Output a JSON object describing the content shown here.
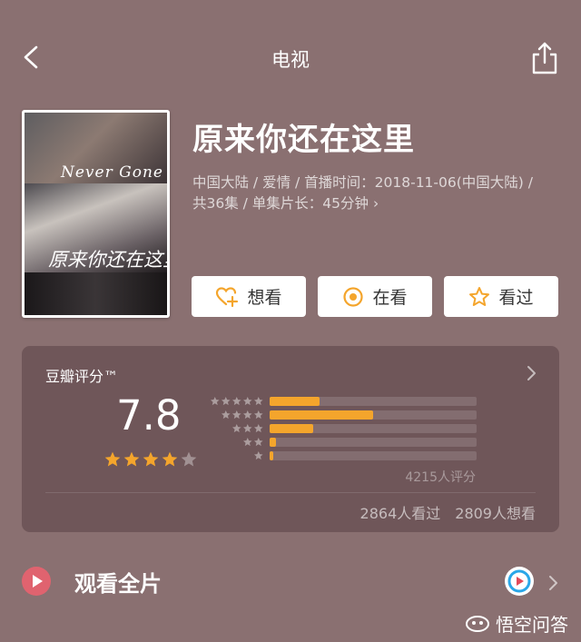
{
  "colors": {
    "background": "#8a7071",
    "star": "#f4a52c",
    "button_icon": "#f4a52c",
    "play": "#e0636f"
  },
  "nav": {
    "title": "电视"
  },
  "show": {
    "title": "原来你还在这里",
    "meta": "中国大陆 / 爱情 / 首播时间：2018-11-06(中国大陆) / 共36集 / 单集片长：45分钟 ›",
    "poster_title_en": "Never Gone",
    "poster_title_cn": "原来你还在这里"
  },
  "actions": {
    "want": "想看",
    "watching": "在看",
    "watched": "看过"
  },
  "rating": {
    "label": "豆瓣评分™",
    "score": "7.8",
    "stars": 4,
    "count": "4215人评分",
    "distribution": [
      {
        "stars": 5,
        "fraction": 0.24
      },
      {
        "stars": 4,
        "fraction": 0.5
      },
      {
        "stars": 3,
        "fraction": 0.21
      },
      {
        "stars": 2,
        "fraction": 0.03
      },
      {
        "stars": 1,
        "fraction": 0.015
      }
    ],
    "seen": "2864人看过",
    "want": "2809人想看"
  },
  "watch": {
    "label": "观看全片"
  },
  "watermark": {
    "text": "悟空问答"
  }
}
